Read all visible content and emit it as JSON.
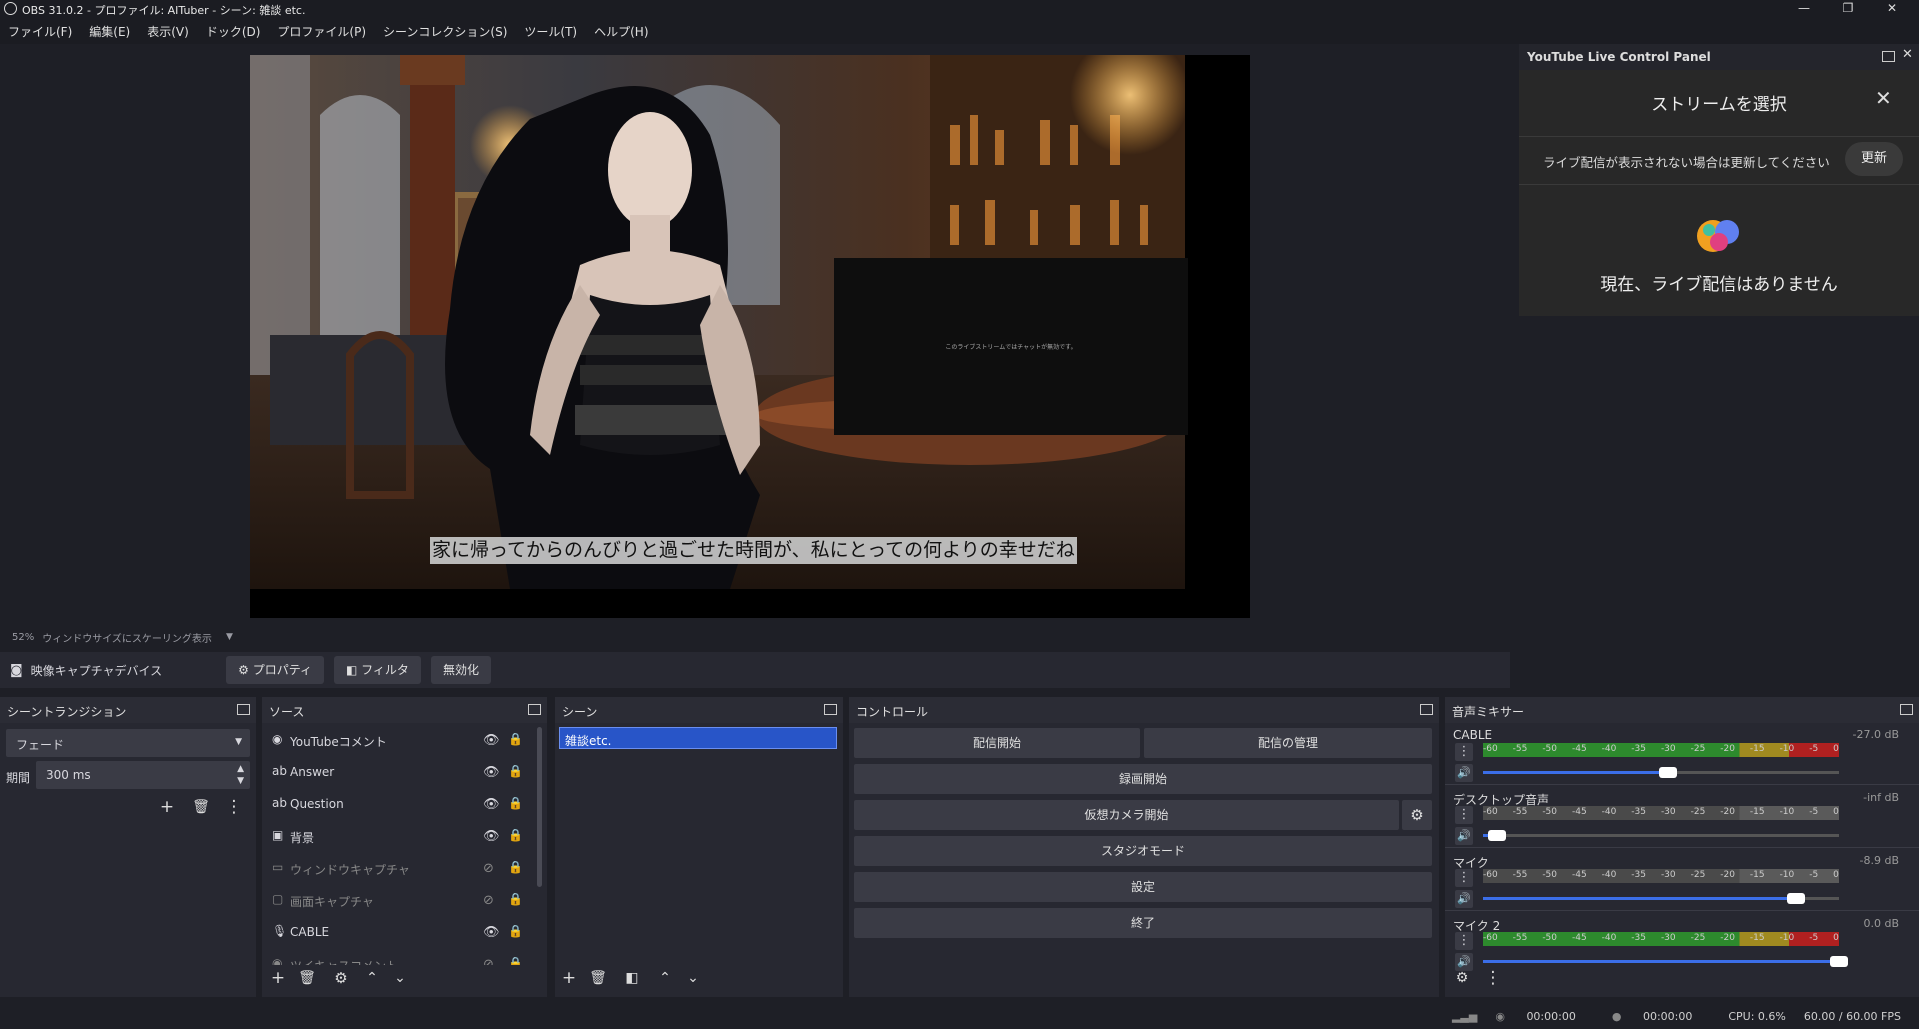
{
  "window": {
    "title": "OBS 31.0.2 - プロファイル: AITuber - シーン: 雑談 etc.",
    "minimize": "—",
    "maximize": "❐",
    "close": "✕"
  },
  "menu": [
    "ファイル(F)",
    "編集(E)",
    "表示(V)",
    "ドック(D)",
    "プロファイル(P)",
    "シーンコレクション(S)",
    "ツール(T)",
    "ヘルプ(H)"
  ],
  "preview": {
    "subtitle": "家に帰ってからのんびりと過ごせた時間が、私にとっての何よりの幸せだね",
    "chat_text": "このライブストリームではチャットが無効です。",
    "zoom": "52%",
    "scale_mode": "ウィンドウサイズにスケーリング表示"
  },
  "source_toolbar": {
    "source_name": "映像キャプチャデバイス",
    "properties": "プロパティ",
    "filters": "フィルタ",
    "disable": "無効化"
  },
  "youtube_panel": {
    "title": "YouTube Live Control Panel",
    "dialog_title": "ストリームを選択",
    "info": "ライブ配信が表示されない場合は更新してください",
    "refresh": "更新",
    "empty": "現在、ライブ配信はありません"
  },
  "transitions": {
    "title": "シーントランジション",
    "selected": "フェード",
    "duration_label": "期間",
    "duration": "300 ms"
  },
  "sources": {
    "title": "ソース",
    "items": [
      {
        "name": "YouTubeコメント",
        "icon": "browser-icon",
        "visible": true
      },
      {
        "name": "Answer",
        "icon": "text-icon",
        "visible": true
      },
      {
        "name": "Question",
        "icon": "text-icon",
        "visible": true
      },
      {
        "name": "背景",
        "icon": "image-icon",
        "visible": true
      },
      {
        "name": "ウィンドウキャプチャ",
        "icon": "window-icon",
        "visible": false
      },
      {
        "name": "画面キャプチャ",
        "icon": "display-icon",
        "visible": false
      },
      {
        "name": "CABLE",
        "icon": "mic-icon",
        "visible": true
      },
      {
        "name": "ツイキャスコメント",
        "icon": "browser-icon",
        "visible": false
      }
    ]
  },
  "scenes": {
    "title": "シーン",
    "items": [
      "雑談etc."
    ]
  },
  "controls": {
    "title": "コントロール",
    "start_stream": "配信開始",
    "manage_stream": "配信の管理",
    "start_record": "録画開始",
    "start_vcam": "仮想カメラ開始",
    "studio_mode": "スタジオモード",
    "settings": "設定",
    "exit": "終了"
  },
  "mixer": {
    "title": "音声ミキサー",
    "scale": [
      "-60",
      "-55",
      "-50",
      "-45",
      "-40",
      "-35",
      "-30",
      "-25",
      "-20",
      "-15",
      "-10",
      "-5",
      "0"
    ],
    "channels": [
      {
        "name": "CABLE",
        "db": "-27.0 dB",
        "level": 0.52,
        "muted": false
      },
      {
        "name": "デスクトップ音声",
        "db": "-inf dB",
        "level": 0.04,
        "muted": true
      },
      {
        "name": "マイク",
        "db": "-8.9 dB",
        "level": 0.88,
        "muted": true
      },
      {
        "name": "マイク 2",
        "db": "0.0 dB",
        "level": 1.0,
        "muted": false
      }
    ]
  },
  "status": {
    "stream_time": "00:00:00",
    "record_time": "00:00:00",
    "cpu": "CPU: 0.6%",
    "fps": "60.00 / 60.00 FPS"
  },
  "colors": {
    "accent": "#3b6ee8",
    "meter_green": "#2d8a2d",
    "meter_yellow": "#a08a20",
    "meter_red": "#b02020"
  }
}
